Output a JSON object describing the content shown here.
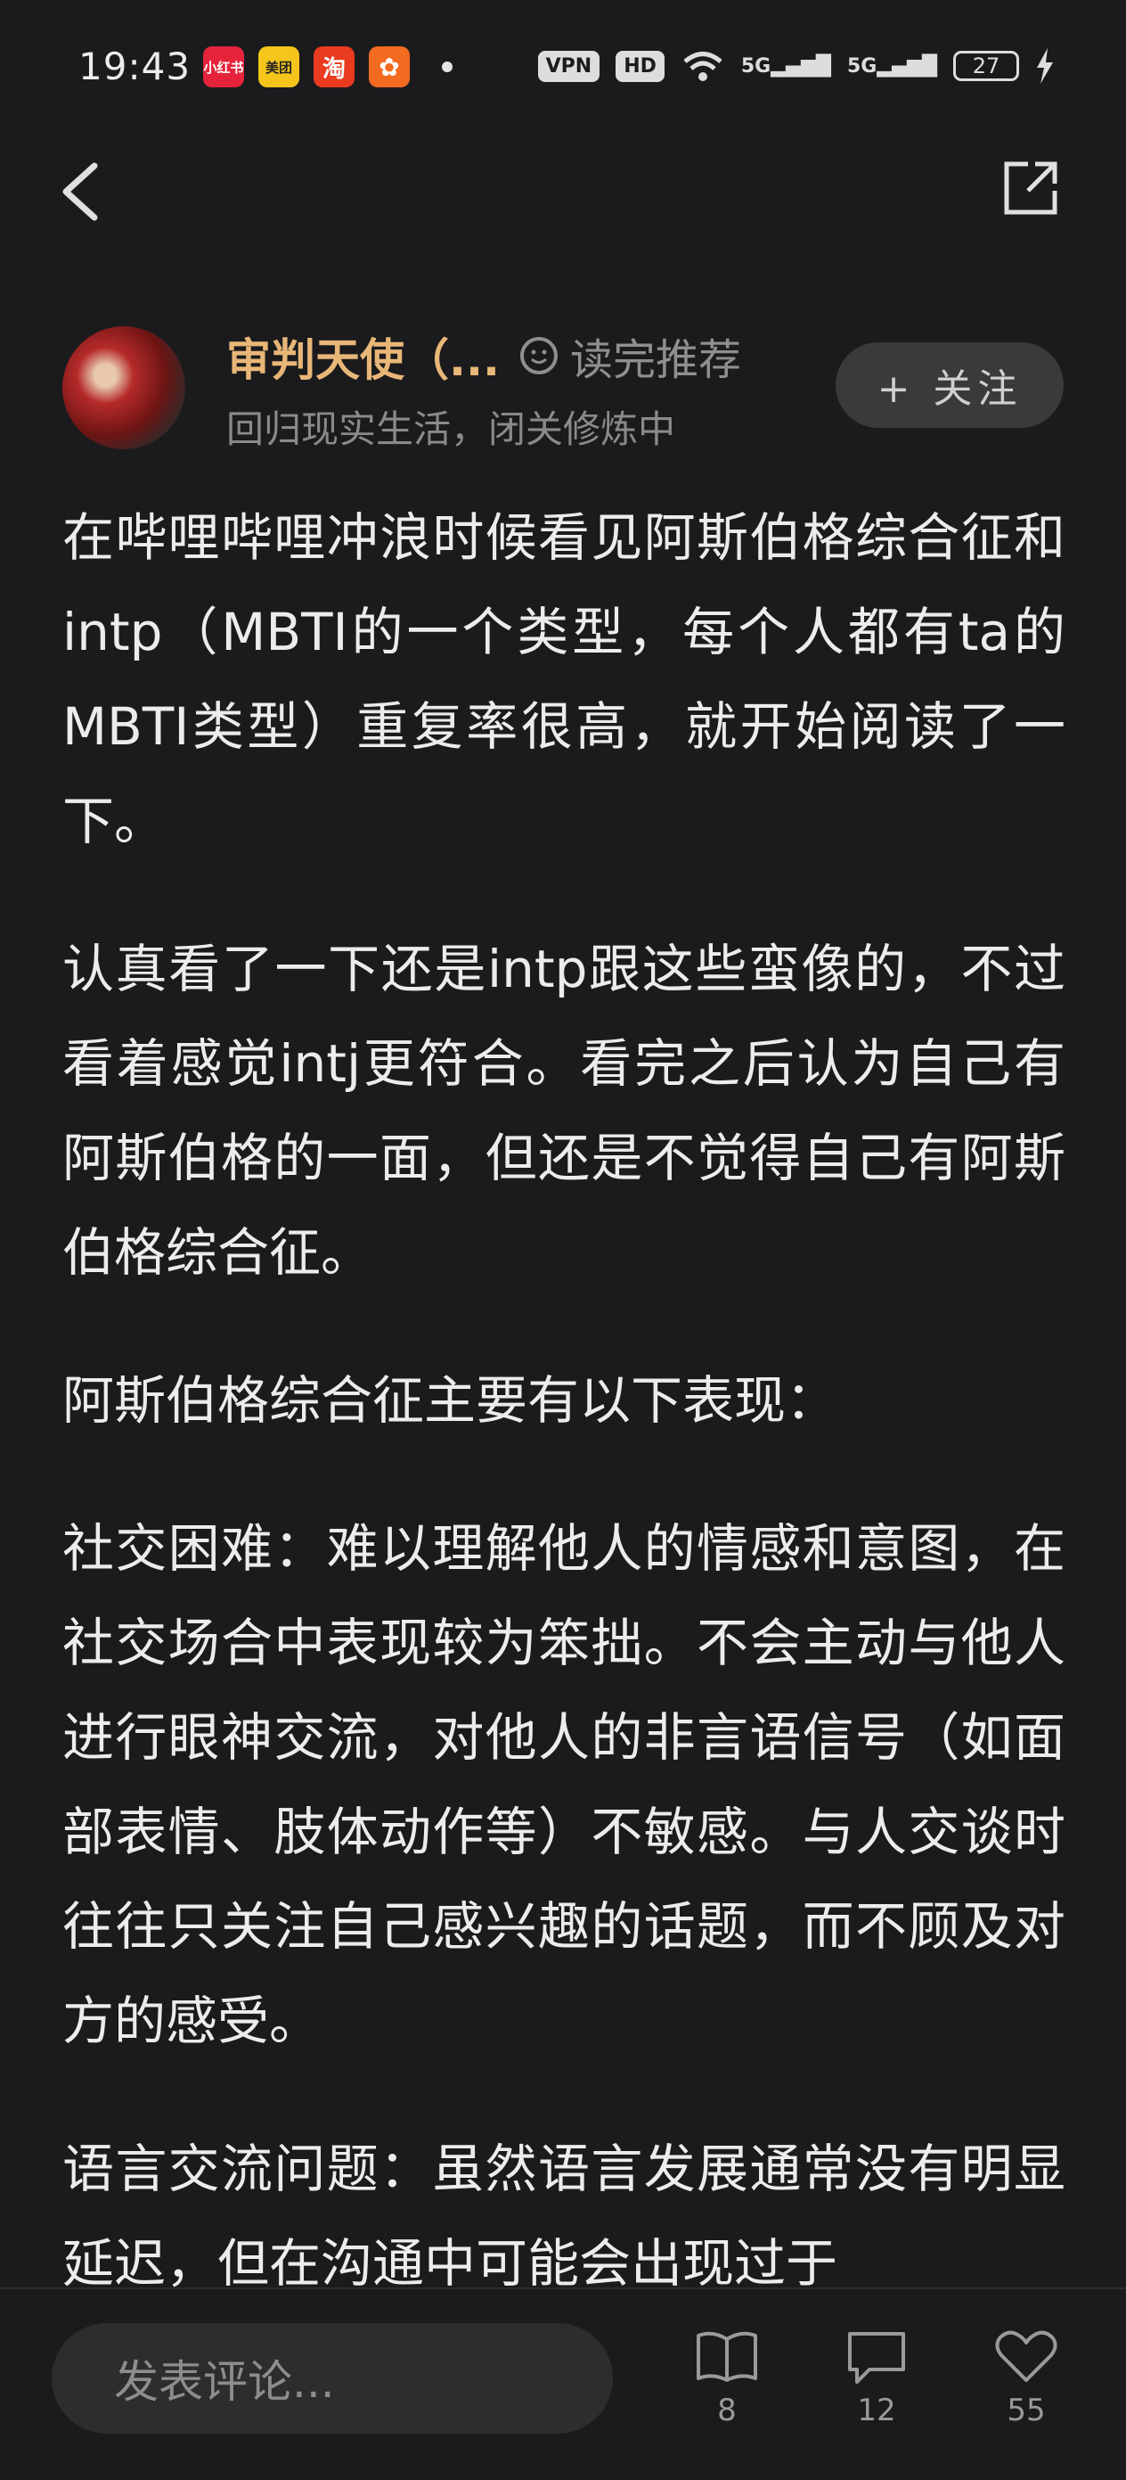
{
  "status_bar": {
    "time": "19:43",
    "apps": [
      {
        "icon": "xiaohongshu-icon",
        "label": "小红书",
        "color": "#e5243c"
      },
      {
        "icon": "meituan-icon",
        "label": "美团",
        "color": "#f5c51b"
      },
      {
        "icon": "taobao-icon",
        "label": "淘",
        "color": "#e83b1f"
      },
      {
        "icon": "app-icon",
        "label": "✿",
        "color": "#f26b20"
      }
    ],
    "vpn": "VPN",
    "hd": "HD",
    "signal1": "5G",
    "signal2": "5G",
    "battery": "27"
  },
  "author": {
    "name": "审判天使（...",
    "read_recommend": "读完推荐",
    "subtitle": "回归现实生活，闭关修炼中",
    "follow_label": "+ 关注"
  },
  "article": {
    "paragraphs": [
      "在哔哩哔哩冲浪时候看见阿斯伯格综合征和intp（MBTI的一个类型，每个人都有ta的MBTI类型）重复率很高，就开始阅读了一下。",
      "认真看了一下还是intp跟这些蛮像的，不过看着感觉intj更符合。看完之后认为自己有阿斯伯格的一面，但还是不觉得自己有阿斯伯格综合征。",
      "阿斯伯格综合征主要有以下表现：",
      "社交困难：难以理解他人的情感和意图，在社交场合中表现较为笨拙。不会主动与他人进行眼神交流，对他人的非言语信号（如面部表情、肢体动作等）不敏感。与人交谈时往往只关注自己感兴趣的话题，而不顾及对方的感受。",
      "语言交流问题：虽然语言发展通常没有明显延迟，但在沟通中可能会出现过于"
    ]
  },
  "bottom_bar": {
    "comment_placeholder": "发表评论...",
    "read_count": "8",
    "comment_count": "12",
    "like_count": "55"
  },
  "colors": {
    "background": "#1b1b1d",
    "author_name": "#e8b778",
    "text": "#ececec",
    "muted": "#8a8a8a"
  }
}
